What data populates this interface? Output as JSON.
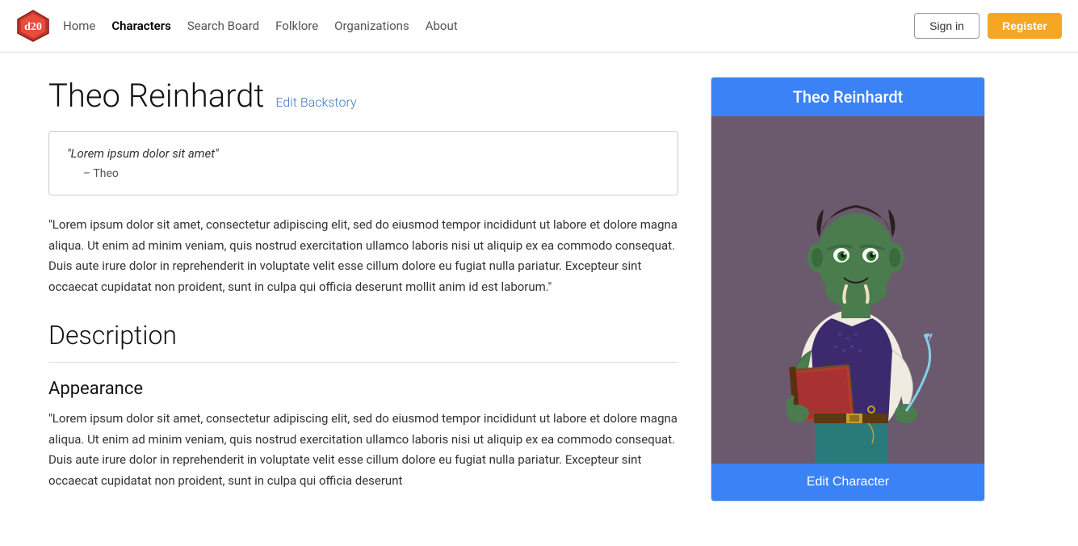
{
  "navbar": {
    "logo_alt": "d20-logo",
    "links": [
      {
        "label": "Home",
        "active": false,
        "id": "home"
      },
      {
        "label": "Characters",
        "active": true,
        "id": "characters"
      },
      {
        "label": "Search Board",
        "active": false,
        "id": "search-board"
      },
      {
        "label": "Folklore",
        "active": false,
        "id": "folklore"
      },
      {
        "label": "Organizations",
        "active": false,
        "id": "organizations"
      },
      {
        "label": "About",
        "active": false,
        "id": "about"
      }
    ],
    "signin_label": "Sign in",
    "register_label": "Register"
  },
  "character": {
    "name": "Theo Reinhardt",
    "edit_backstory_label": "Edit Backstory",
    "quote": "\"Lorem ipsum dolor sit amet\"",
    "quote_attribution": "– Theo",
    "body_paragraph": "\"Lorem ipsum dolor sit amet, consectetur adipiscing elit, sed do eiusmod tempor incididunt ut labore et dolore magna aliqua. Ut enim ad minim veniam, quis nostrud exercitation ullamco laboris nisi ut aliquip ex ea commodo consequat. Duis aute irure dolor in reprehenderit in voluptate velit esse cillum dolore eu fugiat nulla pariatur. Excepteur sint occaecat cupidatat non proident, sunt in culpa qui officia deserunt mollit anim id est laborum.\"",
    "description_heading": "Description",
    "appearance_heading": "Appearance",
    "appearance_paragraph": "\"Lorem ipsum dolor sit amet, consectetur adipiscing elit, sed do eiusmod tempor incididunt ut labore et dolore magna aliqua. Ut enim ad minim veniam, quis nostrud exercitation ullamco laboris nisi ut aliquip ex ea commodo consequat. Duis aute irure dolor in reprehenderit in voluptate velit esse cillum dolore eu fugiat nulla pariatur. Excepteur sint occaecat cupidatat non proident, sunt in culpa qui officia deserunt"
  },
  "sidebar": {
    "character_name": "Theo Reinhardt",
    "edit_character_label": "Edit Character",
    "bg_color": "#6b5a6e",
    "header_color": "#3b82f6"
  }
}
